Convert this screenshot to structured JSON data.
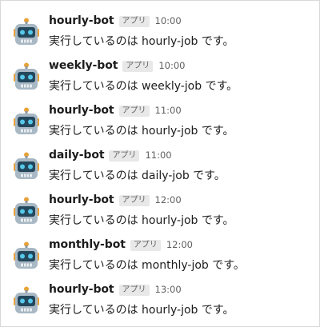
{
  "messages": [
    {
      "name": "hourly-bot",
      "badge": "アプリ",
      "time": "10:00",
      "text": "実行しているのは hourly-job です。"
    },
    {
      "name": "weekly-bot",
      "badge": "アプリ",
      "time": "10:00",
      "text": "実行しているのは weekly-job です。"
    },
    {
      "name": "hourly-bot",
      "badge": "アプリ",
      "time": "11:00",
      "text": "実行しているのは hourly-job です。"
    },
    {
      "name": "daily-bot",
      "badge": "アプリ",
      "time": "11:00",
      "text": "実行しているのは daily-job です。"
    },
    {
      "name": "hourly-bot",
      "badge": "アプリ",
      "time": "12:00",
      "text": "実行しているのは hourly-job です。"
    },
    {
      "name": "monthly-bot",
      "badge": "アプリ",
      "time": "12:00",
      "text": "実行しているのは monthly-job です。"
    },
    {
      "name": "hourly-bot",
      "badge": "アプリ",
      "time": "13:00",
      "text": "実行しているのは hourly-job です。"
    }
  ],
  "avatar_icon": "robot-face-icon",
  "colors": {
    "text": "#1d1c1d",
    "muted": "#616061",
    "badge_bg": "#e8e8e8",
    "robot_head": "#a8b8c4",
    "robot_face": "#24475c",
    "robot_eyes": "#55c8ea",
    "robot_antenna": "#e8a23a"
  }
}
